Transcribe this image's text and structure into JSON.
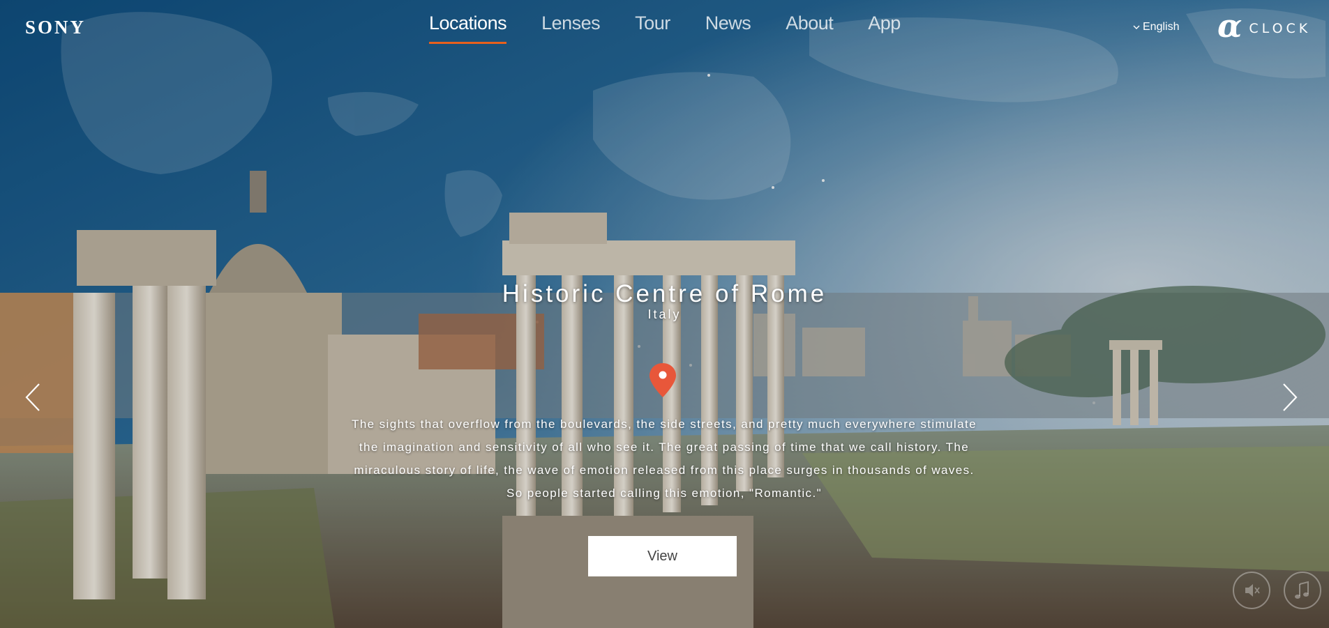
{
  "header": {
    "brand": "SONY",
    "nav": [
      {
        "label": "Locations",
        "active": true
      },
      {
        "label": "Lenses",
        "active": false
      },
      {
        "label": "Tour",
        "active": false
      },
      {
        "label": "News",
        "active": false
      },
      {
        "label": "About",
        "active": false
      },
      {
        "label": "App",
        "active": false
      }
    ],
    "language": "English",
    "alpha_glyph": "α",
    "alpha_word": "CLOCK"
  },
  "location": {
    "title": "Historic Centre of Rome",
    "country": "Italy",
    "description_lines": [
      "The sights that overflow from the boulevards, the side streets, and pretty much everywhere stimulate",
      "the imagination and sensitivity of all who see it. The great passing of time that we call history. The",
      "miraculous story of life, the wave of emotion released from this place surges in thousands of waves.",
      "So people started calling this emotion, \"Romantic.\""
    ],
    "view_label": "View"
  },
  "icons": {
    "prev": "chevron-left-icon",
    "next": "chevron-right-icon",
    "pin": "map-pin-icon",
    "mute": "mute-icon",
    "music": "music-note-icon",
    "language_chevron": "chevron-down-icon"
  },
  "colors": {
    "accent": "#e8601c",
    "pin": "#e8573a",
    "sky_top": "#0f4f80",
    "sky_bottom": "#cfd6dc"
  }
}
